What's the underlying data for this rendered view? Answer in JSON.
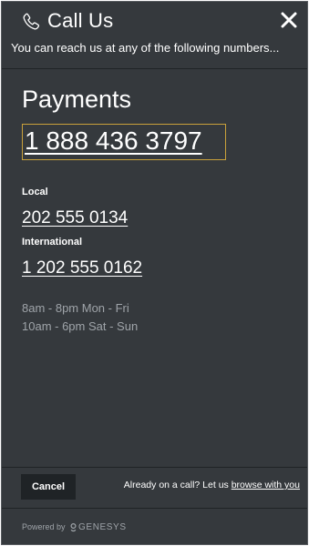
{
  "header": {
    "title": "Call Us",
    "subtitle": "You can reach us at any of the following numbers...",
    "icons": {
      "phone": "phone-icon",
      "close": "close-icon"
    }
  },
  "main": {
    "section_title": "Payments",
    "primary_number": "1 888 436 3797",
    "local_label": "Local",
    "local_number": "202 555 0134",
    "international_label": "International",
    "international_number": "1 202 555 0162",
    "hours": [
      "8am - 8pm Mon - Fri",
      "10am - 6pm Sat - Sun"
    ]
  },
  "footer": {
    "cancel_label": "Cancel",
    "cobrowse_prefix": "Already on a call? Let us ",
    "cobrowse_link": "browse with you",
    "powered_by": "Powered by",
    "brand": "GENESYS"
  },
  "colors": {
    "background": "#35393d",
    "highlight_border": "#c9a13b",
    "muted_text": "#9fa4a9",
    "button_bg": "#1f2326"
  }
}
